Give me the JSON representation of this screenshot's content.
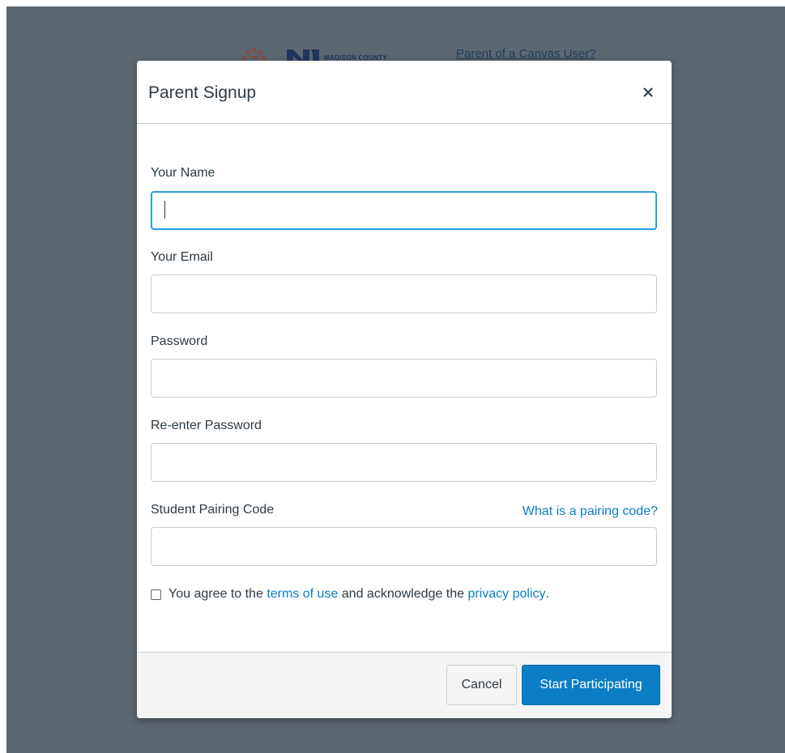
{
  "background": {
    "logo_text": "MADISON COUNTY",
    "parent_link": "Parent of a Canvas User?"
  },
  "modal": {
    "title": "Parent Signup",
    "close_icon": "close-icon",
    "fields": {
      "name_label": "Your Name",
      "name_value": "",
      "email_label": "Your Email",
      "email_value": "",
      "password_label": "Password",
      "password_value": "",
      "reenter_label": "Re-enter Password",
      "reenter_value": "",
      "pairing_label": "Student Pairing Code",
      "pairing_value": "",
      "pairing_help": "What is a pairing code?"
    },
    "agreement": {
      "text_before": "You agree to the ",
      "terms_link": "terms of use",
      "text_middle": " and acknowledge the ",
      "privacy_link": "privacy policy",
      "text_after": "."
    },
    "buttons": {
      "cancel": "Cancel",
      "submit": "Start Participating"
    }
  },
  "colors": {
    "overlay": "#5d6770",
    "link": "#0c7ec6",
    "focus": "#2b9fd8",
    "primary": "#0c7ec6"
  }
}
